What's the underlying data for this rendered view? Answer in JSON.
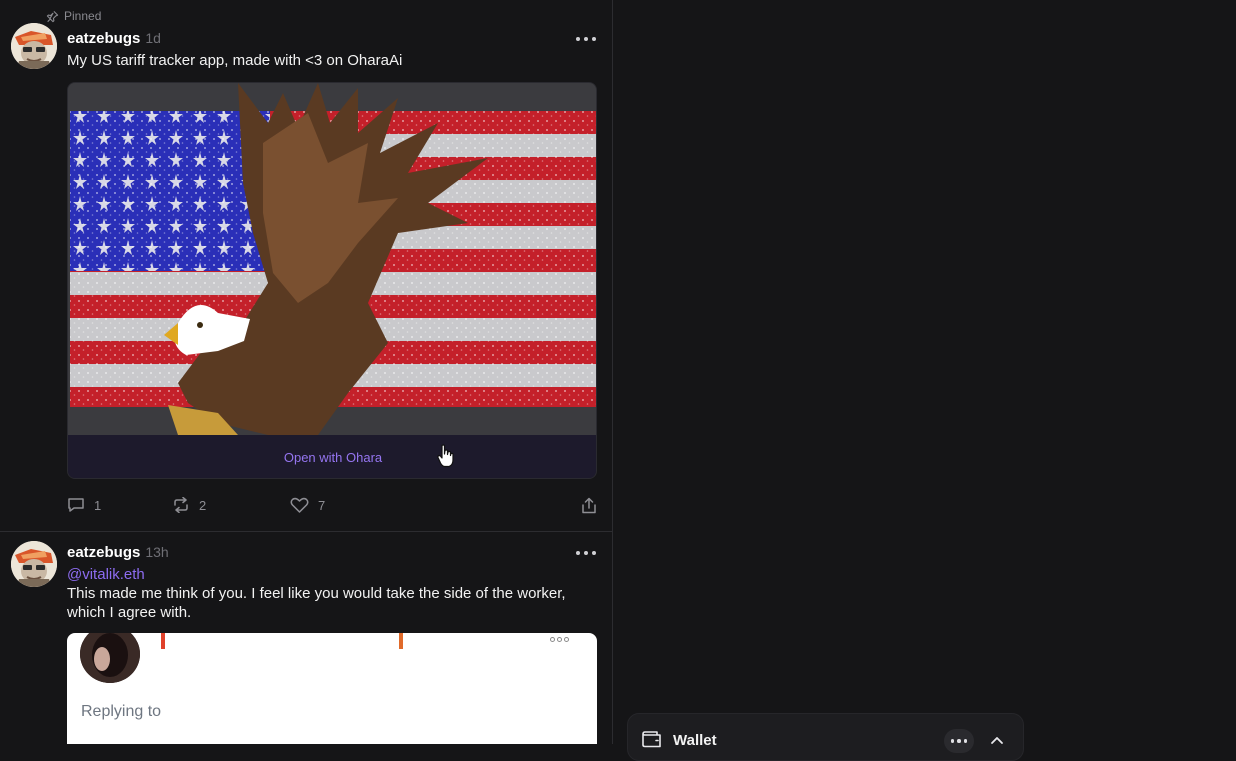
{
  "pinned_label": "Pinned",
  "posts": [
    {
      "author": "eatzebugs",
      "time": "1d",
      "text": "My US tariff tracker app, made with <3 on OharaAi",
      "embed": {
        "button_label": "Open with Ohara"
      },
      "actions": {
        "replies": "1",
        "recasts": "2",
        "likes": "7"
      }
    },
    {
      "author": "eatzebugs",
      "time": "13h",
      "mention": "@vitalik.eth",
      "text": "This made me think of you.  I feel like you would take the side of the worker, which I agree with.",
      "quote": {
        "replying_label": "Replying to"
      }
    }
  ],
  "wallet": {
    "label": "Wallet"
  },
  "colors": {
    "accent": "#8d6cf0",
    "background": "#151517",
    "embed_button_bg": "#1d1a2c"
  }
}
